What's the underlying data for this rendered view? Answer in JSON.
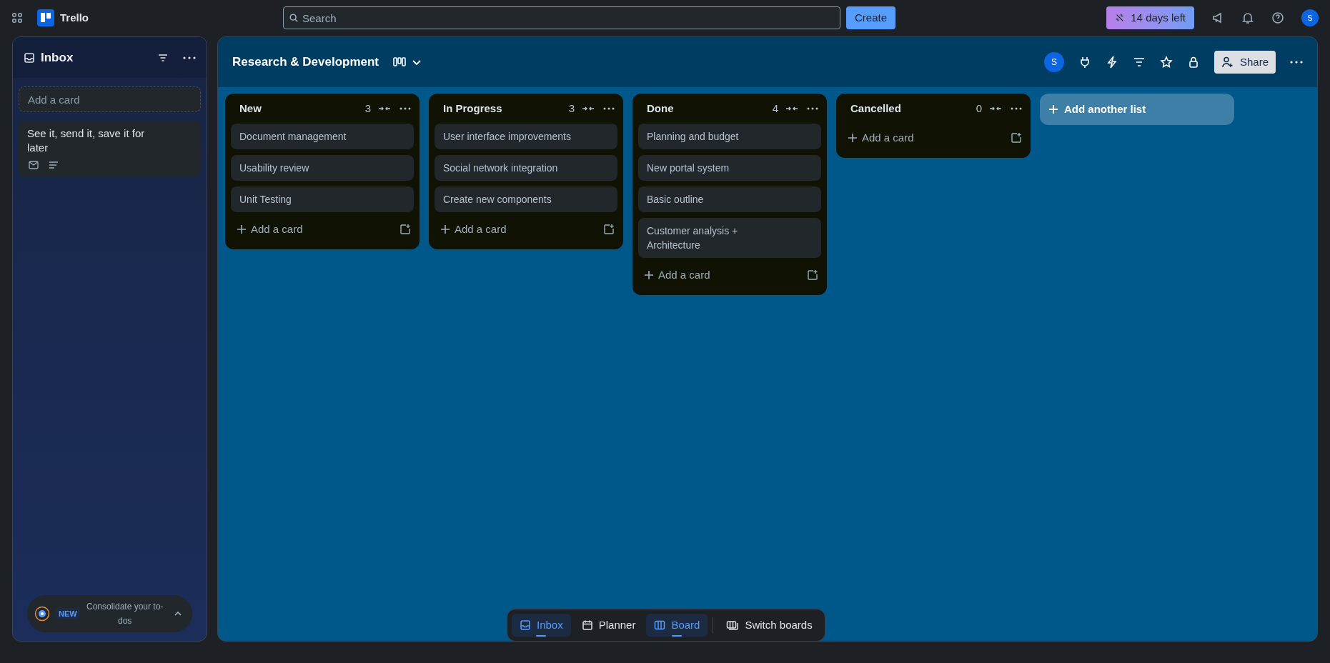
{
  "topbar": {
    "app_name": "Trello",
    "search": {
      "placeholder": "Search"
    },
    "create_button": "Create",
    "trial_badge": "14 days left",
    "avatar_initial": "S"
  },
  "inbox": {
    "title": "Inbox",
    "add_card": {
      "placeholder": "Add a card"
    },
    "cards": [
      {
        "text": "See it, send it, save it for later"
      }
    ],
    "promo": {
      "badge": "NEW",
      "text": "Consolidate your to-dos"
    }
  },
  "board": {
    "title": "Research & Development",
    "member_initial": "S",
    "share_button": "Share",
    "lists": [
      {
        "title": "New",
        "count": "3",
        "cards": [
          "Document management",
          "Usability review",
          "Unit Testing"
        ],
        "add_card": "Add a card"
      },
      {
        "title": "In Progress",
        "count": "3",
        "cards": [
          "User interface improvements",
          "Social network integration",
          "Create new components"
        ],
        "add_card": "Add a card"
      },
      {
        "title": "Done",
        "count": "4",
        "cards": [
          "Planning and budget",
          "New portal system",
          "Basic outline",
          "Customer analysis + Architecture"
        ],
        "add_card": "Add a card"
      },
      {
        "title": "Cancelled",
        "count": "0",
        "add_card": "Add a card"
      }
    ],
    "add_list": "Add another list"
  },
  "bottom_nav": [
    {
      "kind": "inbox",
      "label": "Inbox",
      "selected": true
    },
    {
      "kind": "planner",
      "label": "Planner",
      "selected": false
    },
    {
      "kind": "board",
      "label": "Board",
      "selected": true
    },
    {
      "kind": "switch",
      "label": "Switch boards",
      "selected": false
    }
  ]
}
